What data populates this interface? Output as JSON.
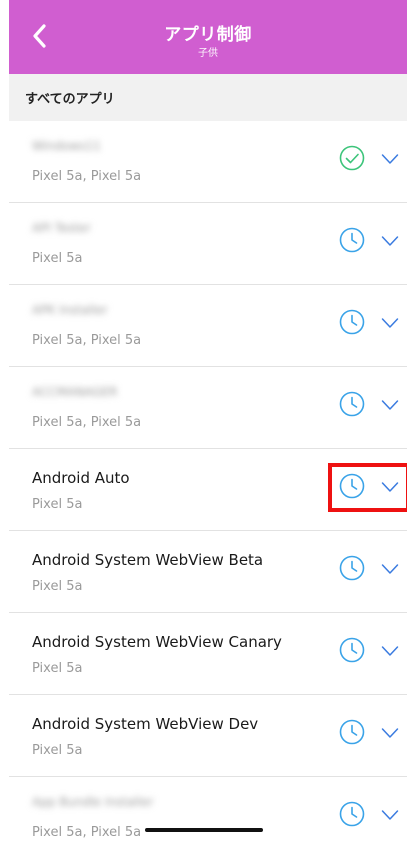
{
  "header": {
    "title": "アプリ制御",
    "subtitle": "子供"
  },
  "section": {
    "title": "すべてのアプリ"
  },
  "colors": {
    "accent": "#d05ed0",
    "status_blue": "#3aa3e8",
    "status_green": "#3cc47a",
    "chevron_blue": "#3a7be0",
    "highlight": "#ee1111"
  },
  "apps": [
    {
      "name": "Windows11",
      "devices": "Pixel 5a, Pixel 5a",
      "status": "check-circle-icon"
    },
    {
      "name": "API Tester",
      "devices": "Pixel 5a",
      "status": "clock-icon"
    },
    {
      "name": "APK Installer",
      "devices": "Pixel 5a, Pixel 5a",
      "status": "clock-icon"
    },
    {
      "name": "ACCMANAGER",
      "devices": "Pixel 5a, Pixel 5a",
      "status": "clock-icon"
    },
    {
      "name": "Android Auto",
      "devices": "Pixel 5a",
      "status": "clock-icon"
    },
    {
      "name": "Android System WebView Beta",
      "devices": "Pixel 5a",
      "status": "clock-icon"
    },
    {
      "name": "Android System WebView Canary",
      "devices": "Pixel 5a",
      "status": "clock-icon"
    },
    {
      "name": "Android System WebView Dev",
      "devices": "Pixel 5a",
      "status": "clock-icon"
    },
    {
      "name": "App Bundle Installer",
      "devices": "Pixel 5a, Pixel 5a",
      "status": "clock-icon"
    }
  ]
}
